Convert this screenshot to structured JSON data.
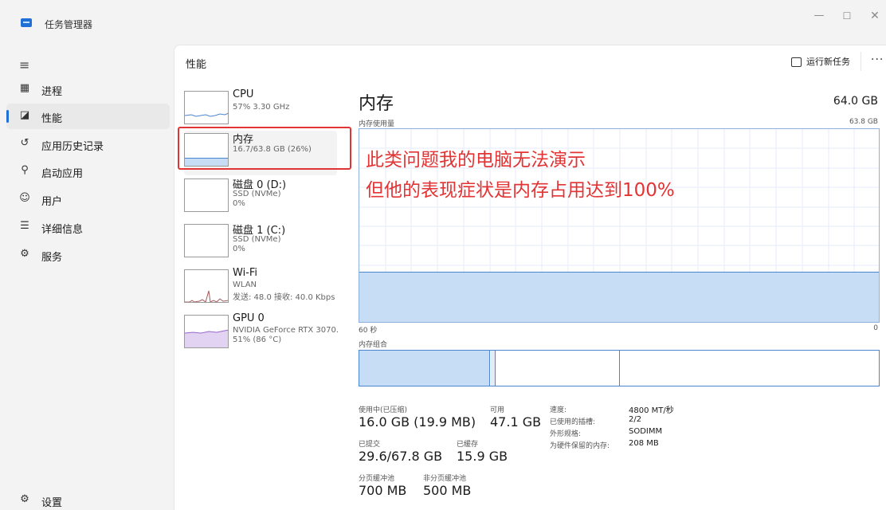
{
  "window": {
    "title": "任务管理器",
    "minimize": "—",
    "maximize": "☐",
    "close": "✕"
  },
  "nav": {
    "menu_icon": "hamburger-icon",
    "items": [
      {
        "label": "进程",
        "icon": "processes-icon"
      },
      {
        "label": "性能",
        "icon": "performance-icon",
        "active": true
      },
      {
        "label": "应用历史记录",
        "icon": "history-icon"
      },
      {
        "label": "启动应用",
        "icon": "startup-icon"
      },
      {
        "label": "用户",
        "icon": "users-icon"
      },
      {
        "label": "详细信息",
        "icon": "details-icon"
      },
      {
        "label": "服务",
        "icon": "services-icon"
      }
    ],
    "settings_label": "设置"
  },
  "header": {
    "title": "性能",
    "run_task": "运行新任务",
    "more": "···"
  },
  "devices": [
    {
      "name": "CPU",
      "sub1": "57% 3.30 GHz",
      "sub2": ""
    },
    {
      "name": "内存",
      "sub1": "16.7/63.8 GB (26%)",
      "sub2": ""
    },
    {
      "name": "磁盘 0 (D:)",
      "sub1": "SSD (NVMe)",
      "sub2": "0%"
    },
    {
      "name": "磁盘 1 (C:)",
      "sub1": "SSD (NVMe)",
      "sub2": "0%"
    },
    {
      "name": "Wi-Fi",
      "sub1": "WLAN",
      "sub2": "发送: 48.0 接收: 40.0 Kbps"
    },
    {
      "name": "GPU 0",
      "sub1": "NVIDIA GeForce RTX 3070.",
      "sub2": "51% (86 °C)"
    }
  ],
  "memory": {
    "title": "内存",
    "total": "64.0 GB",
    "usage_label": "内存使用量",
    "usage_max": "63.8 GB",
    "graph_left": "60 秒",
    "graph_right": "0",
    "usage_fraction": 0.26,
    "composition_label": "内存组合",
    "stats": {
      "in_use_label": "使用中(已压缩)",
      "in_use_value": "16.0 GB (19.9 MB)",
      "available_label": "可用",
      "available_value": "47.1 GB",
      "committed_label": "已提交",
      "committed_value": "29.6/67.8 GB",
      "cached_label": "已缓存",
      "cached_value": "15.9 GB",
      "paged_label": "分页缓冲池",
      "paged_value": "700 MB",
      "nonpaged_label": "非分页缓冲池",
      "nonpaged_value": "500 MB"
    },
    "details": [
      {
        "k": "速度:",
        "v": "4800 MT/秒"
      },
      {
        "k": "已使用的插槽:",
        "v": "2/2"
      },
      {
        "k": "外形规格:",
        "v": "SODIMM"
      },
      {
        "k": "为硬件保留的内存:",
        "v": "208 MB"
      }
    ]
  },
  "annotation": {
    "line1": "此类问题我的电脑无法演示",
    "line2": "但他的表现症状是内存占用达到100%"
  },
  "colors": {
    "accent": "#1f6fd6",
    "annotation": "#e23434",
    "mem_fill": "#c7dcf5",
    "gpu_fill": "#e2d3f3",
    "wifi_line": "#a35a5a"
  }
}
